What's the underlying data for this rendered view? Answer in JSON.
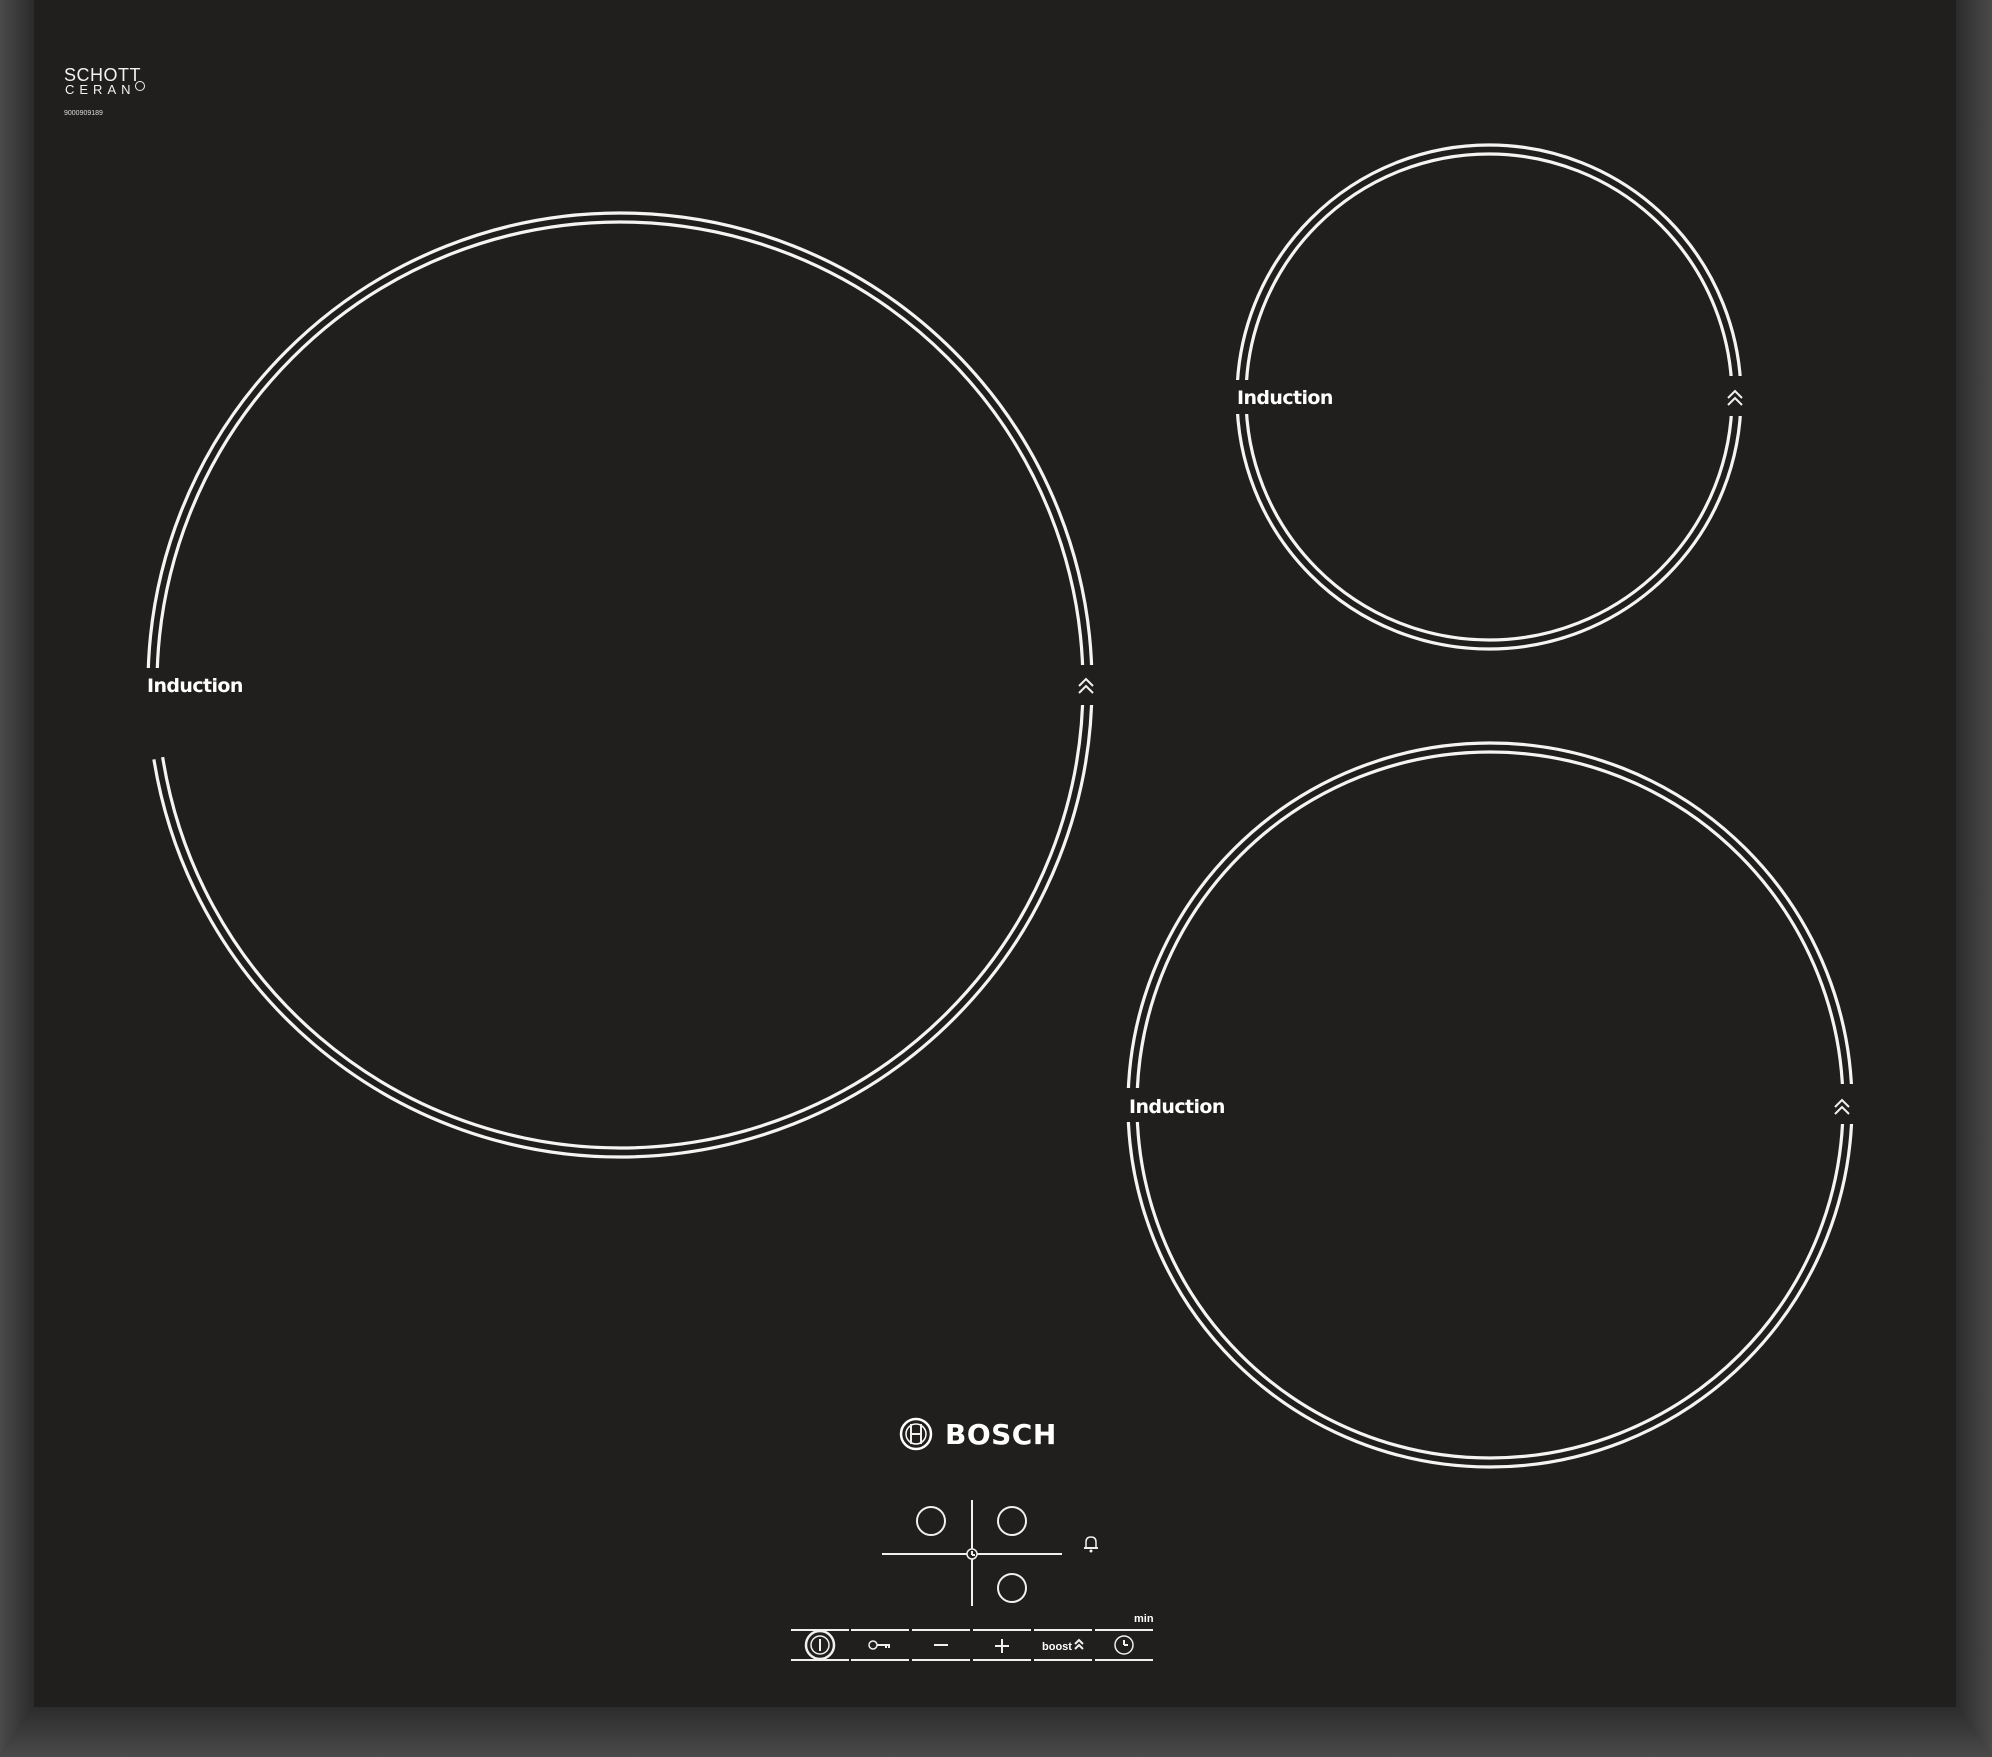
{
  "logo": {
    "brand_line1": "SCHOTT",
    "brand_line2": "CERAN",
    "registered_mark": "®",
    "serial_number": "9000909189"
  },
  "cooking_zones": [
    {
      "id": "zone-front-left",
      "label": "Induction",
      "boost_icon": "double-chevron-up-icon"
    },
    {
      "id": "zone-rear-right",
      "label": "Induction",
      "boost_icon": "double-chevron-up-icon"
    },
    {
      "id": "zone-front-right",
      "label": "Induction",
      "boost_icon": "double-chevron-up-icon"
    }
  ],
  "brand": {
    "name": "BOSCH",
    "logo_icon": "bosch-armature-icon"
  },
  "control_panel": {
    "zone_selector_icon": "zone-selector-icon",
    "timer_alarm_icon": "bell-icon",
    "timer_unit_label": "min",
    "buttons": [
      {
        "name": "power",
        "icon": "power-icon"
      },
      {
        "name": "child-lock",
        "icon": "key-icon"
      },
      {
        "name": "minus",
        "label": "–"
      },
      {
        "name": "plus",
        "label": "+"
      },
      {
        "name": "boost",
        "label": "boost",
        "icon": "double-chevron-up-icon"
      },
      {
        "name": "timer",
        "icon": "clock-icon"
      }
    ]
  },
  "colors": {
    "glass": "#201f1d",
    "frame": "#3a3a3a",
    "print": "#f4f4f4"
  }
}
